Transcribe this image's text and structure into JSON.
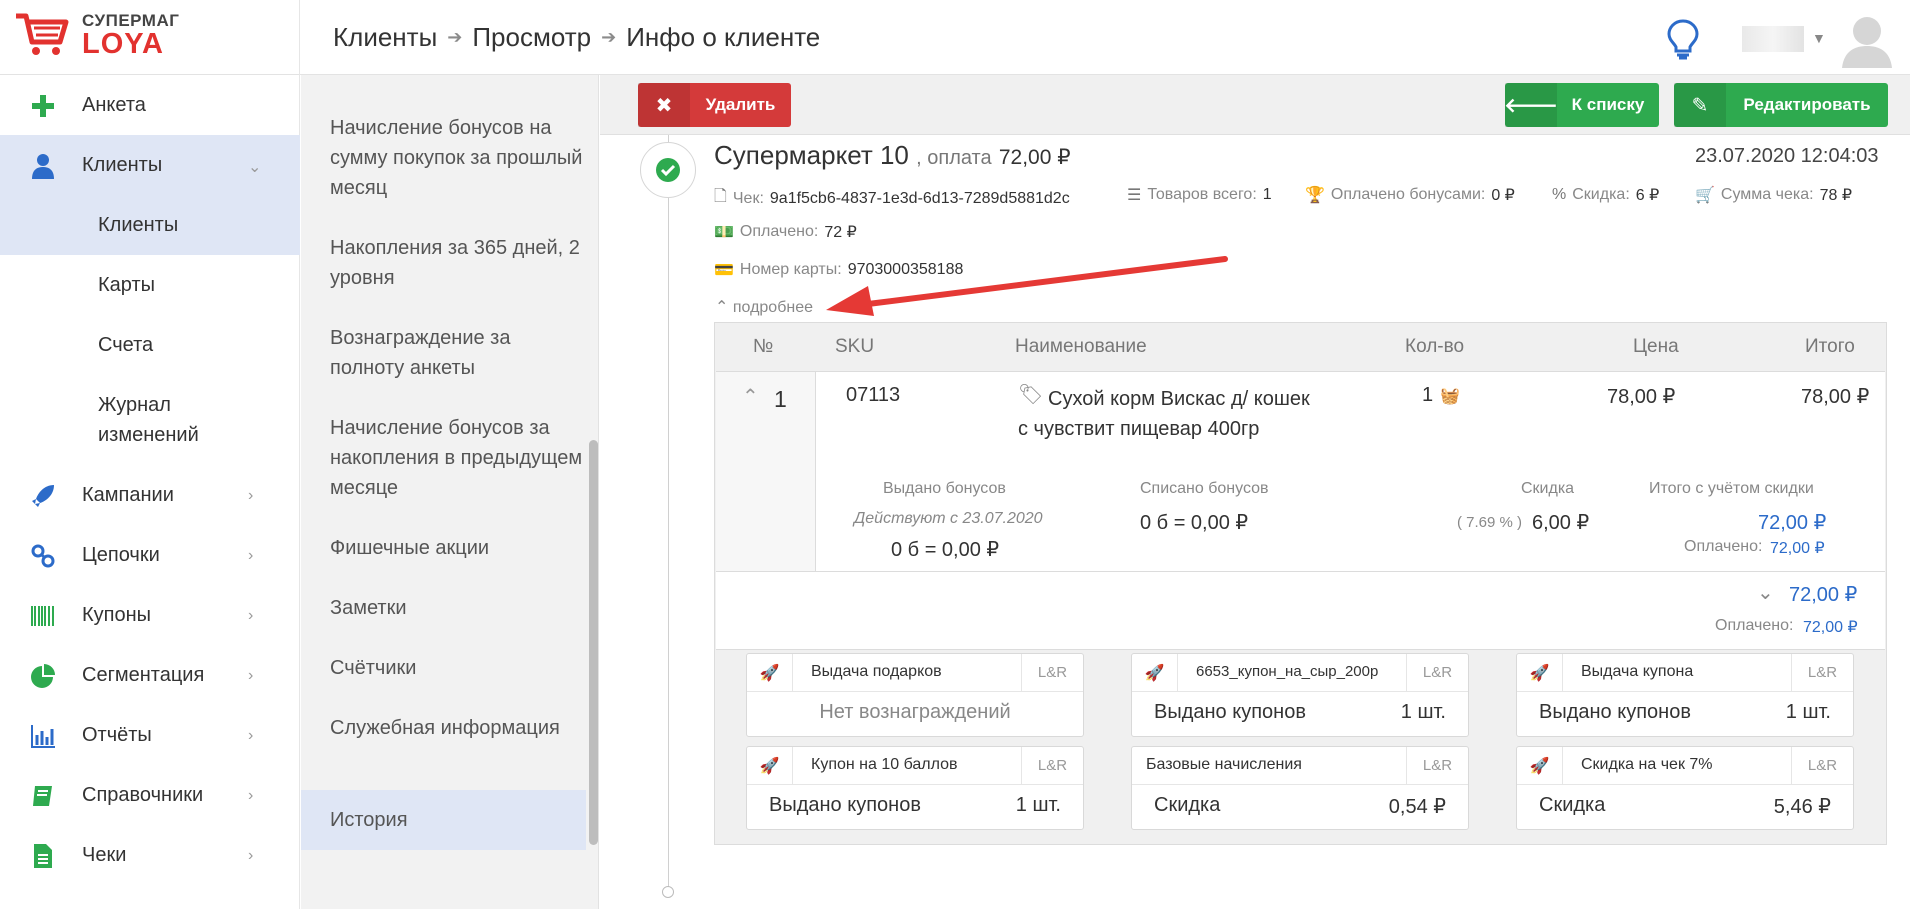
{
  "logo": {
    "top": "СУПЕРМАГ",
    "bottom": "LOYA"
  },
  "breadcrumb": [
    "Клиенты",
    "Просмотр",
    "Инфо о клиенте"
  ],
  "sidebar": {
    "items": [
      {
        "label": "Анкета",
        "icon": "plus-icon"
      },
      {
        "label": "Клиенты",
        "icon": "user-icon"
      },
      {
        "label": "Кампании",
        "icon": "rocket-icon"
      },
      {
        "label": "Цепочки",
        "icon": "chain-icon"
      },
      {
        "label": "Купоны",
        "icon": "barcode-icon"
      },
      {
        "label": "Сегментация",
        "icon": "pie-chart-icon"
      },
      {
        "label": "Отчёты",
        "icon": "bar-chart-icon"
      },
      {
        "label": "Справочники",
        "icon": "book-icon"
      },
      {
        "label": "Чеки",
        "icon": "document-icon"
      }
    ],
    "sub_items": [
      "Клиенты",
      "Карты",
      "Счета",
      "Журнал изменений"
    ]
  },
  "midmenu": {
    "items": [
      "Начисление бонусов на сумму покупок за прошлый месяц",
      "Накопления за 365 дней, 2 уровня",
      "Вознаграждение за полноту анкеты",
      "Начисление бонусов за накопления в предыдущем месяце",
      "Фишечные акции",
      "Заметки",
      "Счётчики",
      "Служебная информация",
      "История"
    ],
    "active": "История"
  },
  "toolbar": {
    "delete_label": "Удалить",
    "back_label": "К списку",
    "edit_label": "Редактировать"
  },
  "check": {
    "store": "Супермаркет 10",
    "payment_label": ", оплата",
    "payment_amount": "72,00 ₽",
    "datetime": "23.07.2020 12:04:03",
    "receipt_label": "Чек:",
    "receipt_id": "9a1f5cb6-4837-1e3d-6d13-7289d5881d2c",
    "items_label": "Товаров всего:",
    "items_count": "1",
    "paid_bonus_label": "Оплачено бонусами:",
    "paid_bonus": "0 ₽",
    "discount_label": "Скидка:",
    "discount": "6 ₽",
    "sum_label": "Сумма чека:",
    "sum": "78 ₽",
    "paid_label": "Оплачено:",
    "paid": "72 ₽",
    "card_label": "Номер карты:",
    "card_number": "9703000358188",
    "more_label": "подробнее"
  },
  "table": {
    "headers": [
      "№",
      "SKU",
      "Наименование",
      "Кол-во",
      "Цена",
      "Итого"
    ],
    "row": {
      "num": "1",
      "sku": "07113",
      "name": "Сухой корм Вискас д/ кошек с чувствит пищевар 400гр",
      "qty": "1",
      "price": "78,00 ₽",
      "total": "78,00 ₽",
      "issued_label": "Выдано бонусов",
      "valid_from": "Действуют с 23.07.2020",
      "issued_value": "0 б = 0,00 ₽",
      "written_label": "Списано бонусов",
      "written_value": "0 б = 0,00 ₽",
      "discount_label": "Скидка",
      "discount_pct": "( 7.69 % )",
      "discount_value": "6,00 ₽",
      "total_disc_label": "Итого с учётом скидки",
      "total_disc_value": "72,00 ₽",
      "paid_label": "Оплачено:",
      "paid_value": "72,00 ₽"
    },
    "summary": {
      "total": "72,00 ₽",
      "paid_label": "Оплачено:",
      "paid_value": "72,00 ₽"
    }
  },
  "cards": [
    {
      "title": "Выдача подарков",
      "tag": "L&R",
      "body_label": "Нет вознаграждений",
      "body_value": "",
      "icon": "rocket-icon"
    },
    {
      "title": "6653_купон_на_сыр_200р",
      "tag": "L&R",
      "body_label": "Выдано купонов",
      "body_value": "1 шт.",
      "icon": "rocket-icon"
    },
    {
      "title": "Выдача купона",
      "tag": "L&R",
      "body_label": "Выдано купонов",
      "body_value": "1 шт.",
      "icon": "rocket-icon"
    },
    {
      "title": "Купон на 10 баллов",
      "tag": "L&R",
      "body_label": "Выдано купонов",
      "body_value": "1 шт.",
      "icon": "rocket-icon"
    },
    {
      "title": "Базовые начисления",
      "tag": "L&R",
      "body_label": "Скидка",
      "body_value": "0,54 ₽",
      "icon": ""
    },
    {
      "title": "Скидка на чек 7%",
      "tag": "L&R",
      "body_label": "Скидка",
      "body_value": "5,46 ₽",
      "icon": "rocket-icon"
    }
  ],
  "colors": {
    "brand_red": "#e2322f",
    "accent_blue": "#2c6bc9",
    "green": "#2eaa4f",
    "delete_red": "#d43a3a",
    "annotation_arrow": "#e53935"
  }
}
